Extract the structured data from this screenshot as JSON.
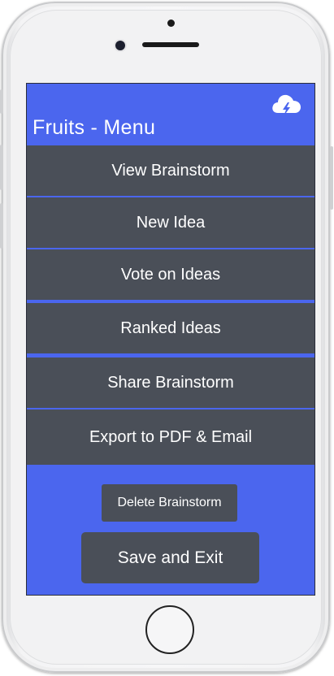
{
  "app": {
    "title": "Fruits - Menu"
  },
  "header": {
    "sync_icon": "cloud-lightning-icon"
  },
  "menu": {
    "items": [
      {
        "label": "View Brainstorm"
      },
      {
        "label": "New Idea"
      },
      {
        "label": "Vote on Ideas"
      },
      {
        "label": "Ranked Ideas"
      },
      {
        "label": "Share Brainstorm"
      },
      {
        "label": "Export to PDF & Email"
      }
    ]
  },
  "actions": {
    "delete_label": "Delete Brainstorm",
    "save_label": "Save and Exit"
  },
  "colors": {
    "accent": "#4b66ee",
    "menu_bg": "#4a4f58",
    "text": "#ffffff"
  }
}
